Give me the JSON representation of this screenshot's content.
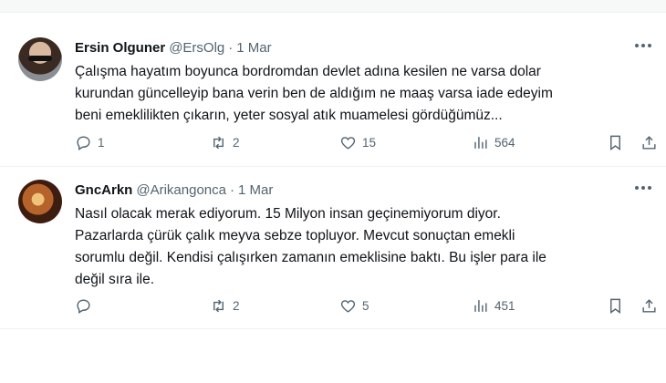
{
  "tweets": [
    {
      "name": "Ersin Olguner",
      "handle": "@ErsOlg",
      "dot": "·",
      "date": "1 Mar",
      "text": "Çalışma hayatım boyunca bordromdan devlet adına kesilen ne varsa dolar\nkurundan güncelleyip bana verin ben de aldığım ne maaş varsa iade edeyim\nbeni emeklilikten çıkarın, yeter sosyal atık muamelesi gördüğümüz...",
      "replies": "1",
      "retweets": "2",
      "likes": "15",
      "views": "564"
    },
    {
      "name": "GncArkn",
      "handle": "@Arikangonca",
      "dot": "·",
      "date": "1 Mar",
      "text": "Nasıl olacak merak ediyorum. 15 Milyon insan geçinemiyorum diyor.\nPazarlarda çürük çalık meyva sebze topluyor. Mevcut sonuçtan emekli\nsorumlu değil. Kendisi çalışırken zamanın emeklisine baktı. Bu işler para ile\ndeğil sıra ile.",
      "replies": "",
      "retweets": "2",
      "likes": "5",
      "views": "451"
    }
  ],
  "icons": {
    "reply": "reply-icon",
    "retweet": "retweet-icon",
    "like": "heart-icon",
    "views": "views-icon",
    "bookmark": "bookmark-icon",
    "share": "share-icon",
    "more": "more-icon"
  },
  "colors": {
    "text": "#0f1419",
    "secondary": "#536471",
    "divider": "#eff3f4"
  }
}
